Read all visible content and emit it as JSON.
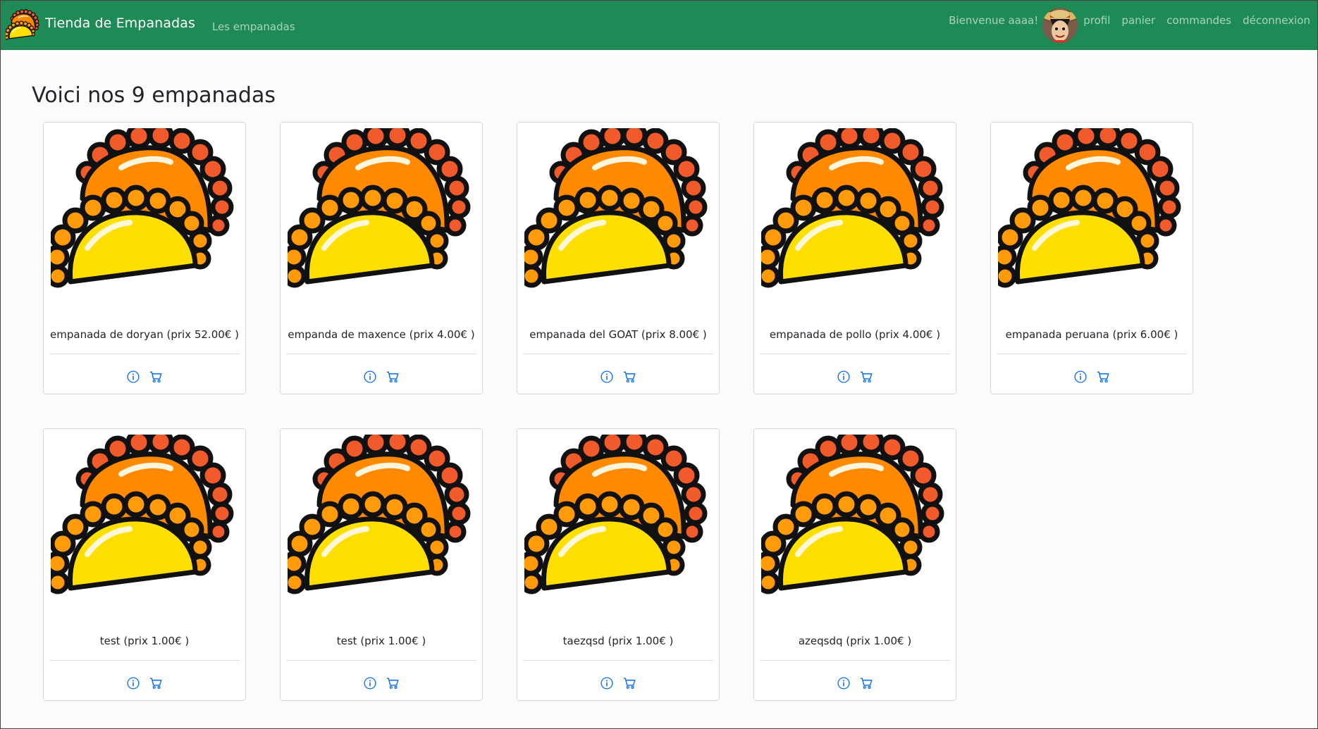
{
  "navbar": {
    "brand": "Tienda de Empanadas",
    "link": "Les empanadas",
    "welcome": "Bienvenue aaaa!",
    "items": [
      "profil",
      "panier",
      "commandes",
      "déconnexion"
    ],
    "background": "#1e8a55"
  },
  "page": {
    "heading": "Voici nos 9 empanadas"
  },
  "products": [
    {
      "label": "empanada de doryan (prix 52.00€ )"
    },
    {
      "label": "empanda de maxence (prix 4.00€ )"
    },
    {
      "label": "empanada del GOAT (prix 8.00€ )"
    },
    {
      "label": "empanada de pollo (prix 4.00€ )"
    },
    {
      "label": "empanada peruana (prix 6.00€ )"
    },
    {
      "label": "test (prix 1.00€ )"
    },
    {
      "label": "test (prix 1.00€ )"
    },
    {
      "label": "taezqsd (prix 1.00€ )"
    },
    {
      "label": "azeqsdq (prix 1.00€ )"
    }
  ],
  "icons": {
    "info": "info-circle-icon",
    "cart": "cart-icon",
    "accent": "#0d6efd"
  }
}
